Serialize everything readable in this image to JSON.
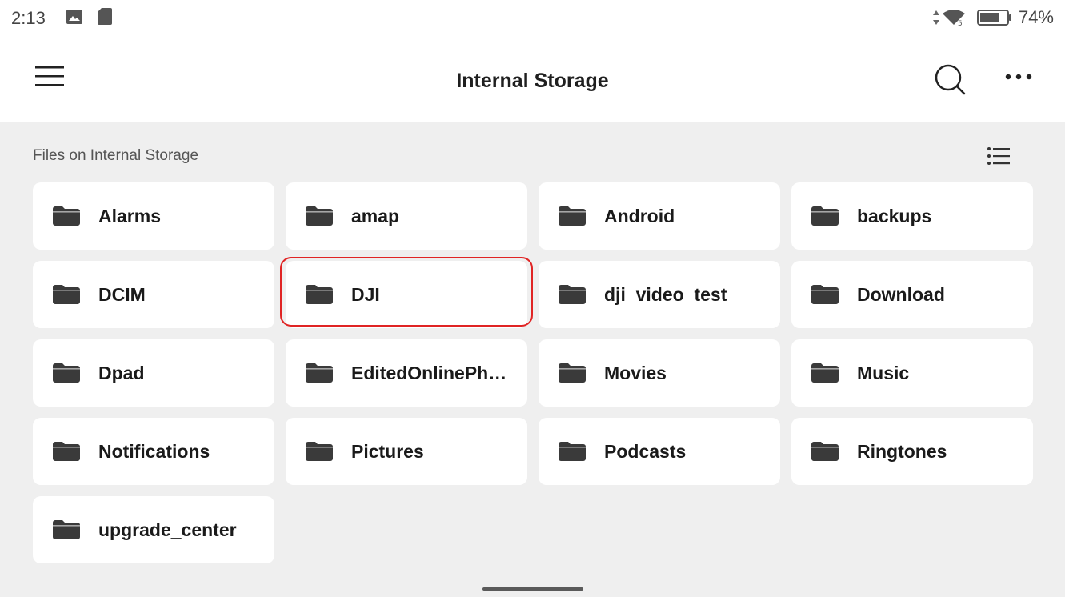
{
  "status_bar": {
    "time": "2:13",
    "battery_percent": "74%",
    "battery_level": 0.74,
    "icons": [
      "image-icon",
      "sd-card-icon",
      "data-arrows-icon",
      "wifi-icon",
      "battery-icon"
    ]
  },
  "app_bar": {
    "title": "Internal Storage",
    "icons": [
      "hamburger-menu-icon",
      "search-icon",
      "more-options-icon"
    ]
  },
  "section": {
    "label": "Files on Internal Storage",
    "view_toggle_icon": "list-view-icon"
  },
  "folders": [
    {
      "name": "Alarms"
    },
    {
      "name": "amap"
    },
    {
      "name": "Android"
    },
    {
      "name": "backups"
    },
    {
      "name": "DCIM"
    },
    {
      "name": "DJI",
      "highlighted": true
    },
    {
      "name": "dji_video_test"
    },
    {
      "name": "Download"
    },
    {
      "name": "Dpad"
    },
    {
      "name": "EditedOnlinePh…"
    },
    {
      "name": "Movies"
    },
    {
      "name": "Music"
    },
    {
      "name": "Notifications"
    },
    {
      "name": "Pictures"
    },
    {
      "name": "Podcasts"
    },
    {
      "name": "Ringtones"
    },
    {
      "name": "upgrade_center"
    }
  ],
  "colors": {
    "background": "#efefef",
    "surface": "#ffffff",
    "icon": "#3a3a3a",
    "highlight": "#e02424"
  }
}
